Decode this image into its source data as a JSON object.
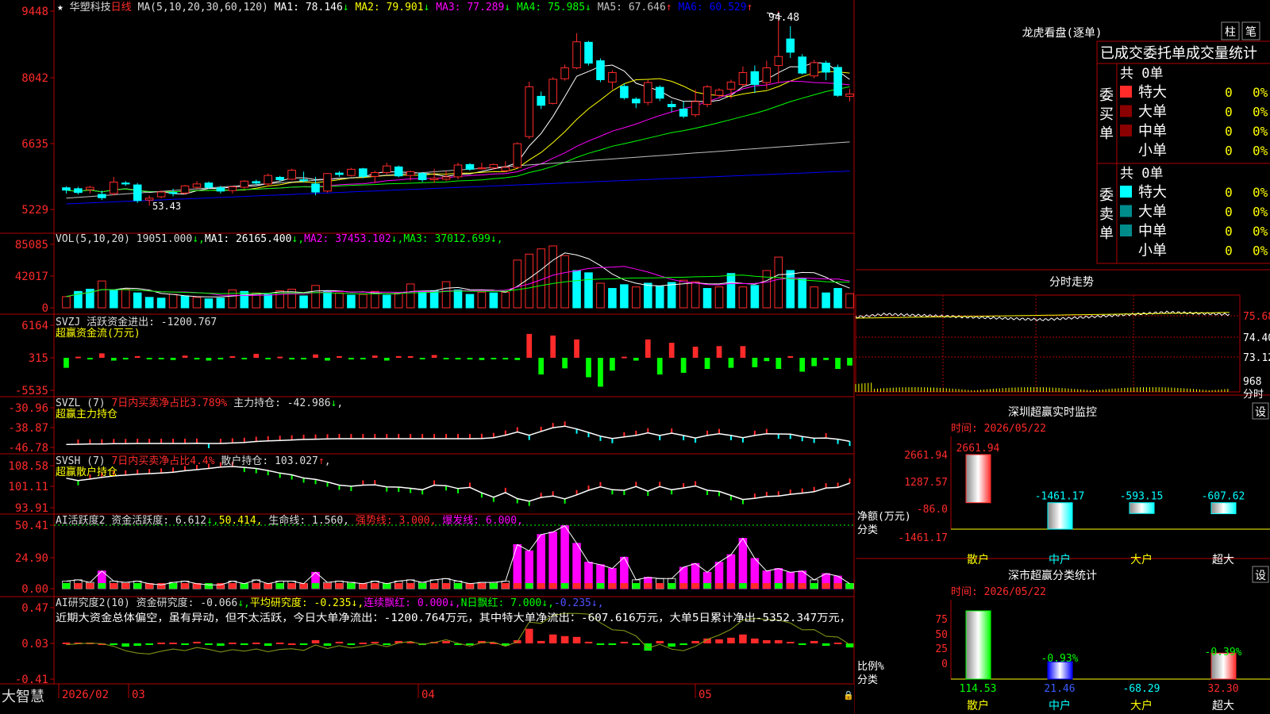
{
  "stock": {
    "name": "华塑科技",
    "period": "日线",
    "star": "★"
  },
  "ma_legend": {
    "prefix": "MA(5,10,20,30,60,120)",
    "items": [
      {
        "label": "MA1: 78.146",
        "arrow": "↓",
        "color": "#ffffff"
      },
      {
        "label": "MA2: 79.901",
        "arrow": "↓",
        "color": "#ffff00"
      },
      {
        "label": "MA3: 77.289",
        "arrow": "↓",
        "color": "#ff00ff"
      },
      {
        "label": "MA4: 75.985",
        "arrow": "↓",
        "color": "#00ff00"
      },
      {
        "label": "MA5: 67.646",
        "arrow": "↑",
        "color": "#c0c0c0"
      },
      {
        "label": "MA6: 60.529",
        "arrow": "↑",
        "color": "#0000ff"
      }
    ]
  },
  "price_axis": [
    "9448",
    "8042",
    "6635",
    "5229"
  ],
  "price_marks": {
    "high": "94.48",
    "low": "53.43"
  },
  "vol_legend": {
    "prefix": "VOL(5,10,20)",
    "value": "19051.000",
    "items": [
      {
        "label": "MA1: 26165.400",
        "arrow": "↓",
        "color": "#ffffff"
      },
      {
        "label": "MA2: 37453.102",
        "arrow": "↓",
        "color": "#ff00ff"
      },
      {
        "label": "MA3: 37012.699",
        "arrow": "↓",
        "color": "#00ff00"
      }
    ]
  },
  "vol_axis": [
    "85085",
    "42017",
    "0"
  ],
  "svzj": {
    "l1": "SVZJ  活跃资金进出: -1200.767",
    "l1_arrow": "↑",
    "l1_tail": ",",
    "l2": "超赢资金流(万元)",
    "axis": [
      "6164",
      "315",
      "-5535"
    ]
  },
  "svzl": {
    "l1a": "SVZL (7)",
    "l1b": "7日内买卖净占比3.789%",
    "l1c": "主力持仓: -42.986",
    "l1_arrow": "↓",
    "l1_tail": ",",
    "l2": "超赢主力持仓",
    "axis": [
      "-30.96",
      "-38.87",
      "-46.78"
    ]
  },
  "svsh": {
    "l1a": "SVSH (7)",
    "l1b": "7日内买卖净占比4.4%",
    "l1c": "散户持仓: 103.027",
    "l1_arrow": "↑",
    "l1_tail": ",",
    "l2": "超赢散户持仓",
    "axis": [
      "108.58",
      "101.11",
      "93.91"
    ]
  },
  "ai1": {
    "l1a": "AI活跃度2 资金活跃度: 6.612",
    "l1_arrow": "↓",
    "l1b": "50.414,",
    "l1c": "生命线: 1.560,",
    "l1d": "强势线: 3.000,",
    "l1e": "爆发线: 6.000,",
    "axis": [
      "50.41",
      "24.90",
      "0.00"
    ]
  },
  "ai2": {
    "l1a": "AI研究度2(10) 资金研究度: -0.066",
    "l1_arrow": "↓",
    "l1b": "平均研究度: -0.235",
    "l1c": "连续飘红: 0.000",
    "l1d": "N日飘红: 7.000",
    "l1e": "-0.235",
    "desc": "近期大资金总体偏空，虽有异动，但不太活跃，今日大单净流出：-1200.764万元，其中特大单净流出：-607.616万元，大单5日累计净出-5352.347万元，",
    "axis": [
      "0.47",
      "0.03",
      "-0.41"
    ]
  },
  "date_axis": {
    "brand": "大智慧",
    "labels": [
      "2026/02",
      "03",
      "04",
      "05"
    ]
  },
  "dragon": {
    "title": "龙虎看盘(逐单)",
    "btn1": "柱",
    "btn2": "笔",
    "subtitle": "已成交委托单成交量统计",
    "buy": {
      "label": "委买单",
      "total": "共 0单",
      "rows": [
        {
          "name": "特大",
          "count": "0",
          "pct": "0%"
        },
        {
          "name": "大单",
          "count": "0",
          "pct": "0%"
        },
        {
          "name": "中单",
          "count": "0",
          "pct": "0%"
        },
        {
          "name": "小单",
          "count": "0",
          "pct": "0%"
        }
      ]
    },
    "sell": {
      "label": "委卖单",
      "total": "共 0单",
      "rows": [
        {
          "name": "特大",
          "count": "0",
          "pct": "0%"
        },
        {
          "name": "大单",
          "count": "0",
          "pct": "0%"
        },
        {
          "name": "中单",
          "count": "0",
          "pct": "0%"
        },
        {
          "name": "小单",
          "count": "0",
          "pct": "0%"
        }
      ]
    }
  },
  "intraday": {
    "title": "分时走势",
    "axis": [
      "75.68",
      "74.40",
      "73.12"
    ],
    "vol_label": "968",
    "vol_unit": "分时"
  },
  "sz_monitor": {
    "title": "深圳超赢实时监控",
    "btn": "设",
    "time": "时间: 2026/05/22",
    "axis": [
      "2661.94",
      "1287.57",
      "-86.0",
      "-1461.17"
    ],
    "ylabel1": "净额(万元)",
    "ylabel2": "分类",
    "bars": [
      {
        "cat": "散户",
        "value": 2661.94,
        "label": "2661.94"
      },
      {
        "cat": "中户",
        "value": -1461.17,
        "label": "-1461.17"
      },
      {
        "cat": "大户",
        "value": -593.15,
        "label": "-593.15"
      },
      {
        "cat": "超大",
        "value": -607.62,
        "label": "-607.62"
      }
    ]
  },
  "sz_class": {
    "title": "深市超赢分类统计",
    "btn": "设",
    "time": "时间: 2026/05/22",
    "axis": [
      "75",
      "50",
      "25",
      "0"
    ],
    "ylabel1": "比例%",
    "ylabel2": "分类",
    "bars": [
      {
        "cat": "散户",
        "value": 114.53,
        "label": "114.53",
        "top": ""
      },
      {
        "cat": "中户",
        "value": 21.46,
        "label": "21.46",
        "top": "-0.93%"
      },
      {
        "cat": "大户",
        "value": -68.29,
        "label": "-68.29",
        "top": ""
      },
      {
        "cat": "超大",
        "value": 32.3,
        "label": "32.30",
        "top": "-0.39%"
      }
    ]
  },
  "chart_data": [
    {
      "type": "candlestick",
      "title": "华塑科技 日线",
      "ylim": [
        52.29,
        94.48
      ],
      "ohlc": [
        [
          57.2,
          57.5,
          56.0,
          56.7
        ],
        [
          57.0,
          57.4,
          55.8,
          56.2
        ],
        [
          56.8,
          57.6,
          56.0,
          57.3
        ],
        [
          55.8,
          56.6,
          54.6,
          55.1
        ],
        [
          56.0,
          59.5,
          55.6,
          58.4
        ],
        [
          58.2,
          58.6,
          57.6,
          58.0
        ],
        [
          57.8,
          58.2,
          54.0,
          54.5
        ],
        [
          54.6,
          55.6,
          53.4,
          55.0
        ],
        [
          55.3,
          56.6,
          55.0,
          56.3
        ],
        [
          56.2,
          57.0,
          55.4,
          56.0
        ],
        [
          56.1,
          57.8,
          55.8,
          57.6
        ],
        [
          57.3,
          58.6,
          57.0,
          58.0
        ],
        [
          58.2,
          58.5,
          57.0,
          57.3
        ],
        [
          57.2,
          57.6,
          56.0,
          56.5
        ],
        [
          56.6,
          57.6,
          56.0,
          57.4
        ],
        [
          57.3,
          58.8,
          57.0,
          58.6
        ],
        [
          58.5,
          58.9,
          57.8,
          58.2
        ],
        [
          58.0,
          60.2,
          57.5,
          59.8
        ],
        [
          59.4,
          59.7,
          58.5,
          58.9
        ],
        [
          59.0,
          61.2,
          58.8,
          60.9
        ],
        [
          58.9,
          60.6,
          58.3,
          58.7
        ],
        [
          58.0,
          59.5,
          55.6,
          56.3
        ],
        [
          56.5,
          60.3,
          56.2,
          60.2
        ],
        [
          60.3,
          60.7,
          59.5,
          60.0
        ],
        [
          59.8,
          61.4,
          59.6,
          61.1
        ],
        [
          61.2,
          61.4,
          59.2,
          59.6
        ],
        [
          59.6,
          60.8,
          58.2,
          60.4
        ],
        [
          60.4,
          62.5,
          60.0,
          61.8
        ],
        [
          61.6,
          61.9,
          59.4,
          59.7
        ],
        [
          59.8,
          60.8,
          58.7,
          60.6
        ],
        [
          60.2,
          60.5,
          58.4,
          58.9
        ],
        [
          58.9,
          61.2,
          58.2,
          59.2
        ],
        [
          59.0,
          60.8,
          58.6,
          59.5
        ],
        [
          59.5,
          62.5,
          59.0,
          62.0
        ],
        [
          62.1,
          62.4,
          60.8,
          61.1
        ],
        [
          61.2,
          62.5,
          61.0,
          61.4
        ],
        [
          61.4,
          62.3,
          61.0,
          62.1
        ],
        [
          60.8,
          62.8,
          60.5,
          61.5
        ],
        [
          61.5,
          66.8,
          61.3,
          66.5
        ],
        [
          68.0,
          79.6,
          67.5,
          78.5
        ],
        [
          76.5,
          77.5,
          73.8,
          74.6
        ],
        [
          75.0,
          80.5,
          74.8,
          80.1
        ],
        [
          80.2,
          83.2,
          79.8,
          82.5
        ],
        [
          82.5,
          89.8,
          82.2,
          88.0
        ],
        [
          87.9,
          88.2,
          83.0,
          83.5
        ],
        [
          84.0,
          84.5,
          79.5,
          80.0
        ],
        [
          79.5,
          82.0,
          78.0,
          81.5
        ],
        [
          78.6,
          79.2,
          75.8,
          76.2
        ],
        [
          75.9,
          76.3,
          74.0,
          75.1
        ],
        [
          75.2,
          80.0,
          74.6,
          79.4
        ],
        [
          78.4,
          78.8,
          75.5,
          76.1
        ],
        [
          74.8,
          75.6,
          73.2,
          74.3
        ],
        [
          73.8,
          75.4,
          71.9,
          72.3
        ],
        [
          72.6,
          77.9,
          72.1,
          75.4
        ],
        [
          74.8,
          78.9,
          74.2,
          78.5
        ],
        [
          76.7,
          78.2,
          76.3,
          77.8
        ],
        [
          78.0,
          80.0,
          76.0,
          79.5
        ],
        [
          79.0,
          82.8,
          78.5,
          81.5
        ],
        [
          81.7,
          83.0,
          77.2,
          79.0
        ],
        [
          79.4,
          84.0,
          78.0,
          82.5
        ],
        [
          83.0,
          94.48,
          79.3,
          84.9
        ],
        [
          88.6,
          91.3,
          84.6,
          85.8
        ],
        [
          84.8,
          85.4,
          81.1,
          81.4
        ],
        [
          80.8,
          84.2,
          80.3,
          83.6
        ],
        [
          83.5,
          84.0,
          79.9,
          81.6
        ],
        [
          82.6,
          83.2,
          76.4,
          76.7
        ],
        [
          76.5,
          78.1,
          75.4,
          77.0
        ]
      ]
    },
    {
      "type": "bar",
      "title": "VOL",
      "ylim": [
        0,
        85085
      ],
      "values": [
        15000,
        22000,
        25000,
        36000,
        24000,
        25000,
        20000,
        14000,
        13000,
        18000,
        16000,
        14000,
        12000,
        13000,
        24000,
        22000,
        20000,
        18000,
        23000,
        25000,
        16000,
        30000,
        22000,
        20000,
        17000,
        18000,
        22000,
        17000,
        20000,
        32000,
        22000,
        23000,
        35000,
        24000,
        18000,
        21000,
        20000,
        21000,
        64000,
        72000,
        79000,
        83000,
        70000,
        50000,
        47000,
        33000,
        26000,
        31000,
        28000,
        33000,
        29000,
        34000,
        37000,
        35000,
        26000,
        28000,
        46000,
        28000,
        30000,
        50000,
        68000,
        50000,
        39000,
        28000,
        20000,
        26000,
        19000
      ],
      "colors": [
        "r",
        "c",
        "c",
        "r",
        "c",
        "r",
        "c",
        "c",
        "c",
        "r",
        "c",
        "r",
        "c",
        "c",
        "r",
        "c",
        "r",
        "c",
        "r",
        "r",
        "c",
        "r",
        "c",
        "r",
        "c",
        "r",
        "r",
        "c",
        "r",
        "r",
        "c",
        "c",
        "r",
        "c",
        "c",
        "r",
        "c",
        "r",
        "r",
        "r",
        "r",
        "r",
        "r",
        "c",
        "c",
        "r",
        "c",
        "c",
        "r",
        "c",
        "c",
        "c",
        "r",
        "r",
        "c",
        "r",
        "c",
        "r",
        "c",
        "r",
        "r",
        "c",
        "c",
        "r",
        "c",
        "c",
        "r"
      ]
    },
    {
      "type": "bar",
      "title": "SVZJ 超赢资金流(万元)",
      "ylim": [
        -5535,
        6164
      ],
      "values": [
        -1800,
        200,
        -300,
        800,
        -500,
        -300,
        300,
        -200,
        -100,
        -400,
        400,
        -300,
        -500,
        -200,
        300,
        -200,
        700,
        -100,
        200,
        -300,
        -200,
        600,
        -500,
        300,
        -300,
        -100,
        400,
        -500,
        300,
        300,
        -200,
        500,
        -200,
        -300,
        -300,
        -400,
        -200,
        -300,
        -400,
        4300,
        -3000,
        4000,
        -1900,
        3300,
        -3500,
        -5200,
        -2300,
        200,
        -500,
        3300,
        -3000,
        2700,
        -2700,
        2000,
        -2000,
        2100,
        -1800,
        2100,
        -1700,
        -600,
        -2000,
        300,
        -2500,
        -1500,
        -400,
        -2000,
        -1400
      ]
    },
    {
      "type": "line",
      "title": "SVZL 超赢主力持仓",
      "ylim": [
        -46.78,
        -30.96
      ],
      "values": [
        -45.6,
        -45.5,
        -45.4,
        -45.4,
        -45.3,
        -45.3,
        -45.2,
        -45.2,
        -45.2,
        -45.2,
        -45.2,
        -45.1,
        -45.2,
        -45.2,
        -45.0,
        -44.8,
        -44.4,
        -44.2,
        -44.0,
        -43.8,
        -43.6,
        -43.5,
        -43.4,
        -43.3,
        -43.3,
        -43.3,
        -43.3,
        -43.3,
        -43.3,
        -43.3,
        -43.3,
        -43.3,
        -43.3,
        -43.3,
        -43.3,
        -43.2,
        -42.9,
        -41.9,
        -40.6,
        -41.9,
        -40.4,
        -38.9,
        -38.3,
        -39.4,
        -40.8,
        -42.3,
        -43.2,
        -42.6,
        -42.0,
        -41.0,
        -42.0,
        -41.1,
        -42.0,
        -43.0,
        -42.0,
        -41.3,
        -42.0,
        -42.9,
        -42.0,
        -41.3,
        -41.4,
        -41.5,
        -42.4,
        -43.1,
        -43.0,
        -43.5,
        -44.3
      ]
    },
    {
      "type": "line",
      "title": "SVSH 超赢散户持仓",
      "ylim": [
        93.91,
        108.58
      ],
      "values": [
        104.2,
        103.4,
        103.9,
        104.5,
        105.0,
        105.3,
        105.6,
        105.8,
        106.0,
        106.3,
        106.8,
        107.2,
        107.6,
        108.1,
        108.3,
        108.0,
        107.6,
        106.9,
        106.0,
        105.4,
        104.3,
        103.8,
        102.9,
        101.8,
        101.4,
        101.8,
        101.9,
        101.2,
        101.1,
        100.7,
        100.2,
        101.8,
        101.6,
        100.6,
        101.0,
        99.1,
        97.6,
        99.2,
        97.1,
        96.2,
        97.5,
        98.0,
        97.0,
        98.4,
        100.0,
        101.2,
        100.2,
        100.0,
        101.3,
        99.7,
        101.3,
        100.2,
        100.8,
        101.5,
        100.0,
        99.6,
        98.2,
        96.8,
        97.2,
        97.8,
        98.0,
        98.6,
        99.0,
        99.5,
        100.8,
        101.0,
        102.5
      ]
    },
    {
      "type": "bar",
      "title": "AI活跃度2",
      "ylim": [
        0,
        50.41
      ],
      "values": [
        6,
        7,
        5,
        14,
        6,
        5,
        6,
        4,
        3,
        5,
        6,
        4,
        3,
        3,
        6,
        4,
        7,
        4,
        6,
        6,
        4,
        13,
        5,
        6,
        5,
        4,
        6,
        4,
        6,
        7,
        5,
        7,
        8,
        6,
        4,
        5,
        5,
        6,
        35,
        30,
        43,
        45,
        50,
        36,
        21,
        19,
        16,
        25,
        7,
        9,
        8,
        8,
        17,
        20,
        13,
        21,
        27,
        40,
        24,
        14,
        16,
        13,
        14,
        7,
        12,
        10,
        4
      ]
    },
    {
      "type": "bar",
      "title": "AI研究度2(10)",
      "ylim": [
        -0.41,
        0.47
      ],
      "values": [
        0.01,
        0.01,
        0.01,
        0.0,
        -0.02,
        -0.04,
        -0.03,
        -0.02,
        0.01,
        0.01,
        -0.02,
        0.02,
        -0.02,
        -0.03,
        0.01,
        -0.02,
        0.01,
        -0.03,
        0.01,
        0.0,
        -0.02,
        0.04,
        -0.03,
        0.02,
        -0.02,
        0.01,
        0.02,
        -0.02,
        0.03,
        0.02,
        -0.02,
        0.02,
        0.03,
        -0.02,
        -0.02,
        0.03,
        0.01,
        -0.03,
        0.04,
        0.18,
        0.03,
        0.11,
        0.09,
        0.08,
        0.02,
        -0.02,
        -0.02,
        0.02,
        -0.02,
        -0.09,
        0.03,
        -0.04,
        -0.02,
        0.03,
        0.06,
        0.05,
        0.07,
        0.11,
        0.06,
        0.04,
        0.04,
        0.02,
        -0.02,
        0.03,
        -0.03,
        0.01,
        -0.05
      ]
    },
    {
      "type": "bar",
      "title": "深圳超赢实时监控",
      "categories": [
        "散户",
        "中户",
        "大户",
        "超大"
      ],
      "values": [
        2661.94,
        -1461.17,
        -593.15,
        -607.62
      ],
      "ylim": [
        -1461.17,
        2661.94
      ]
    },
    {
      "type": "bar",
      "title": "深市超赢分类统计",
      "categories": [
        "散户",
        "中户",
        "大户",
        "超大"
      ],
      "values": [
        114.53,
        21.46,
        -68.29,
        32.3
      ]
    }
  ]
}
